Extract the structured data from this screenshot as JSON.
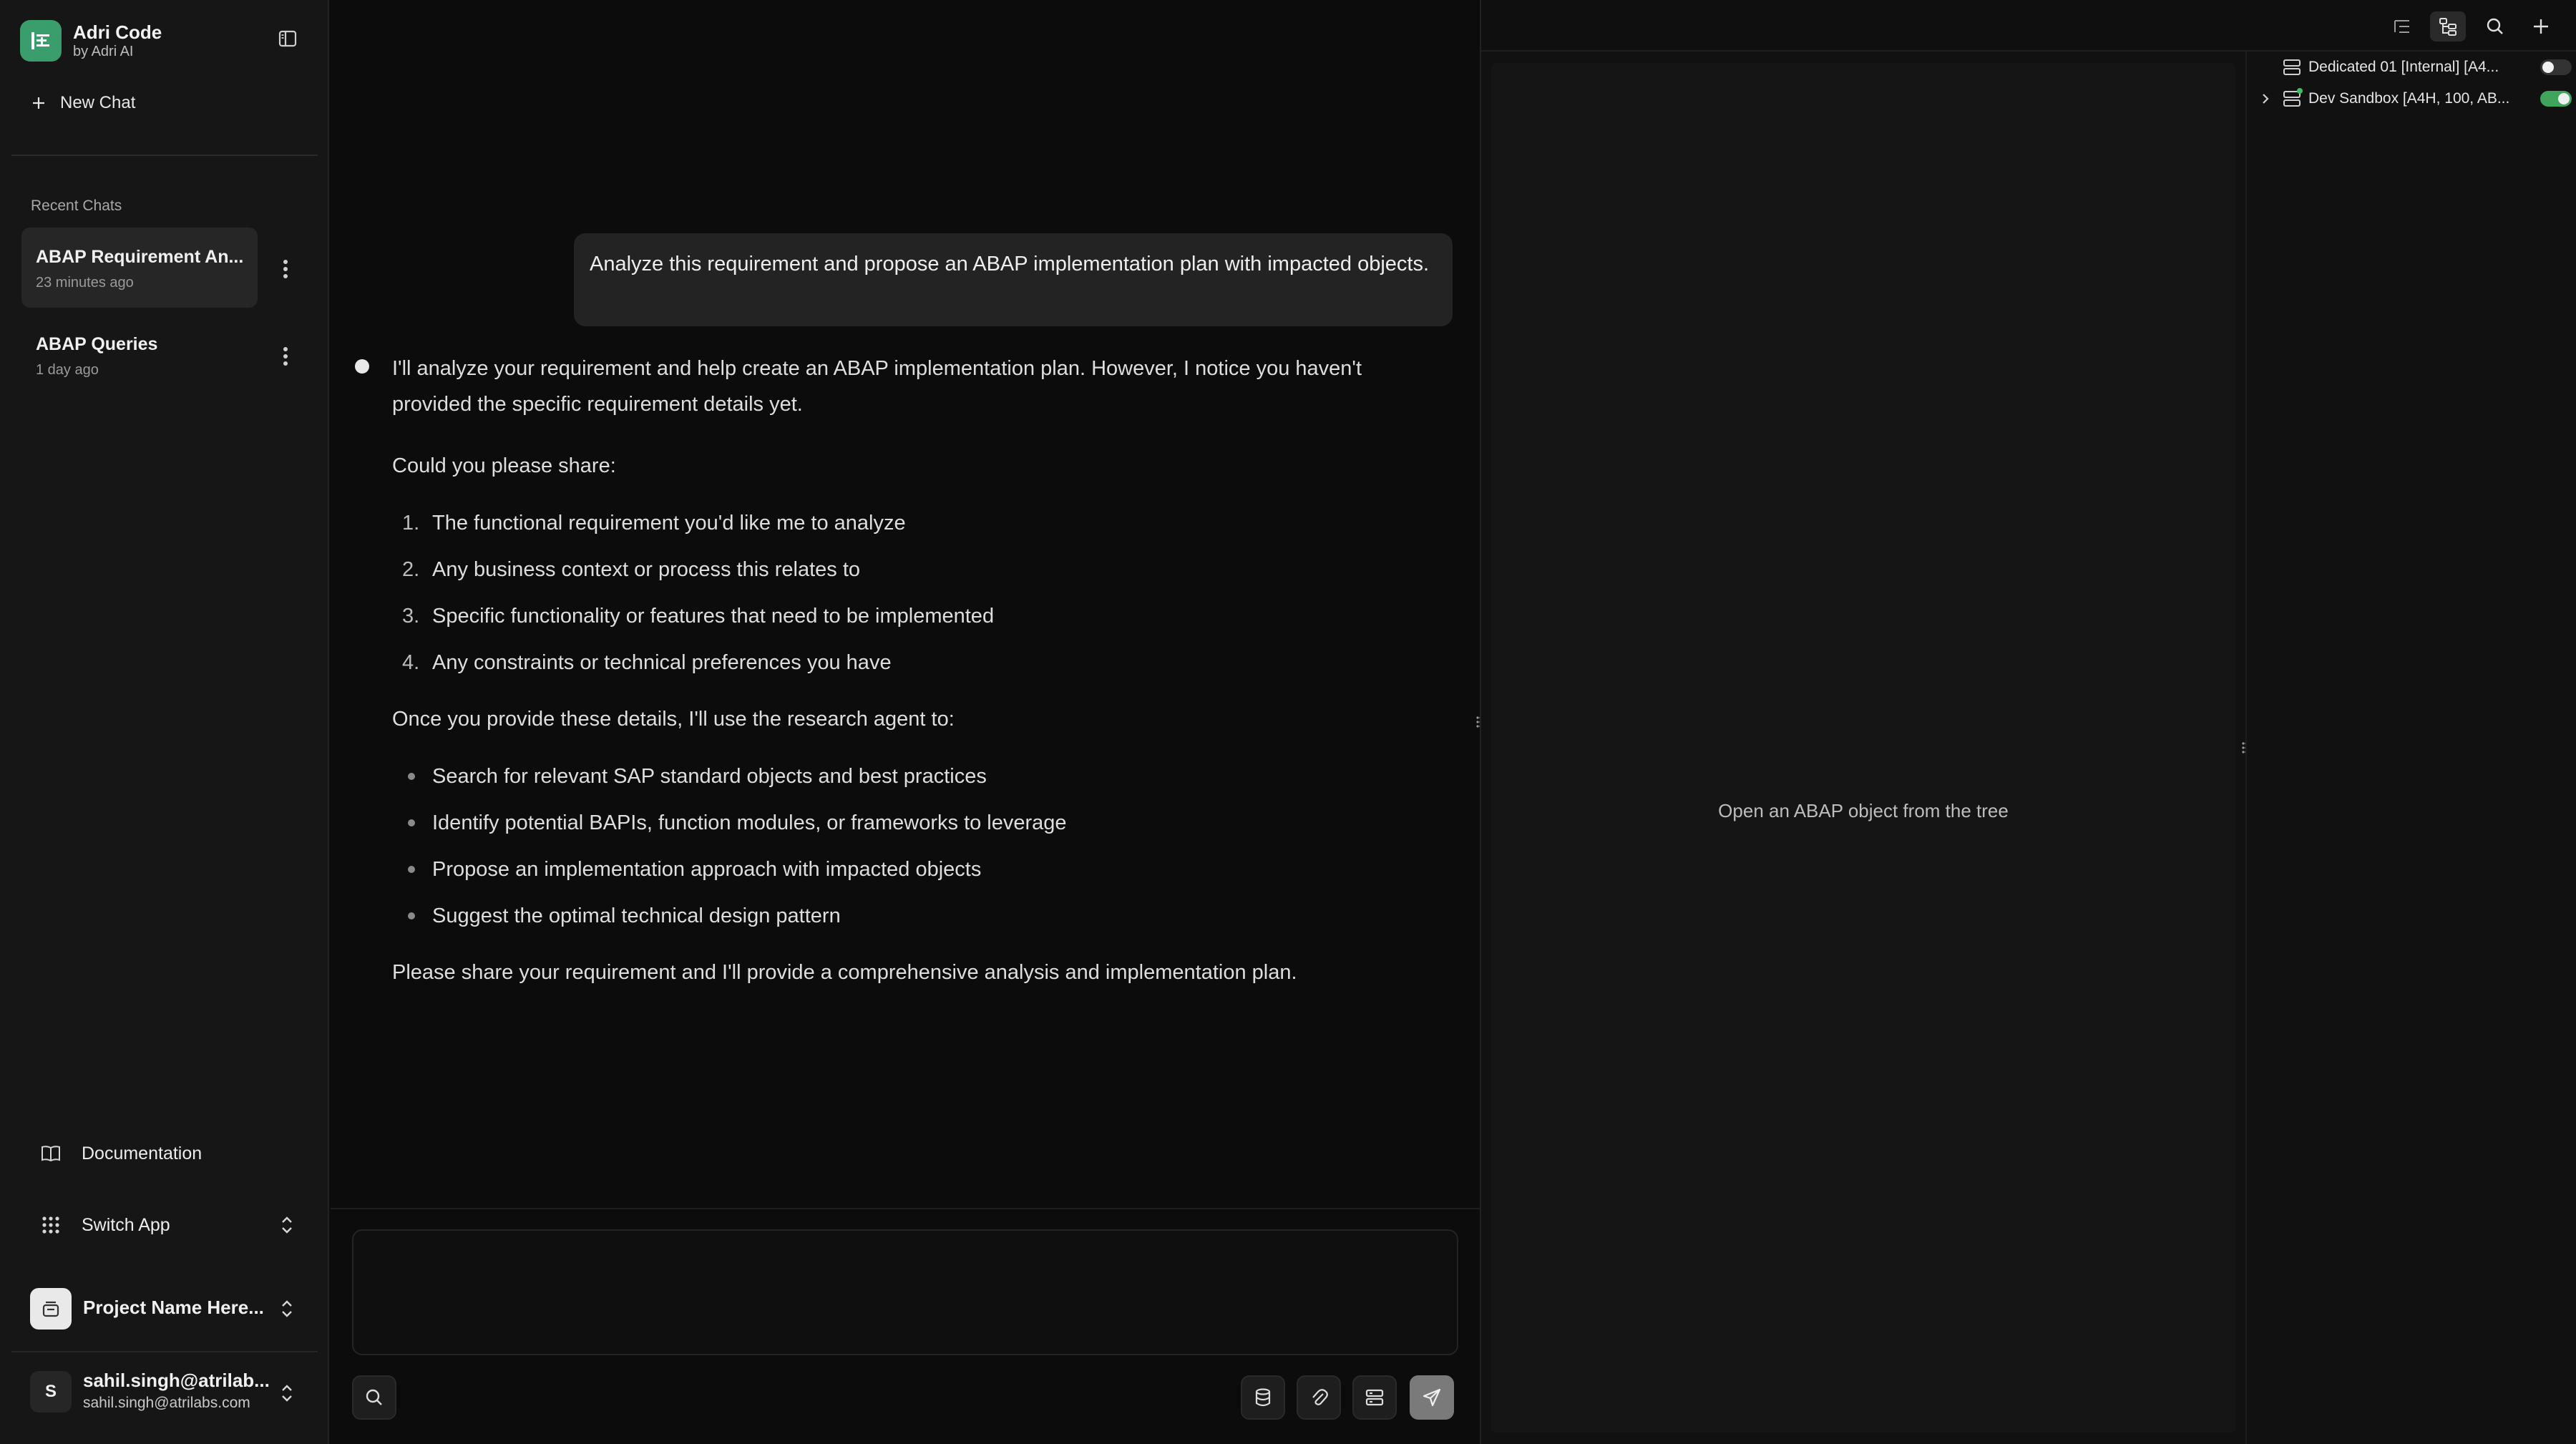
{
  "brand": {
    "name": "Adri Code",
    "subtitle": "by Adri AI"
  },
  "sidebar": {
    "new_chat_label": "New Chat",
    "recent_label": "Recent Chats",
    "chats": [
      {
        "title": "ABAP Requirement An...",
        "time": "23 minutes ago",
        "active": true
      },
      {
        "title": "ABAP Queries",
        "time": "1 day ago",
        "active": false
      }
    ],
    "documentation_label": "Documentation",
    "switch_app_label": "Switch App",
    "project_name": "Project Name Here...",
    "user": {
      "initial": "S",
      "name": "sahil.singh@atrilab...",
      "email": "sahil.singh@atrilabs.com"
    }
  },
  "conversation": {
    "user_message": "Analyze this requirement and propose an ABAP implementation plan with impacted objects.",
    "assistant": {
      "intro": "I'll analyze your requirement and help create an ABAP implementation plan. However, I notice you haven't provided the specific requirement details yet.",
      "ask": "Could you please share:",
      "numbered": [
        "The functional requirement you'd like me to analyze",
        "Any business context or process this relates to",
        "Specific functionality or features that need to be implemented",
        "Any constraints or technical preferences you have"
      ],
      "numbers": [
        "1.",
        "2.",
        "3.",
        "4."
      ],
      "followup": "Once you provide these details, I'll use the research agent to:",
      "bullets": [
        "Search for relevant SAP standard objects and best practices",
        "Identify potential BAPIs, function modules, or frameworks to leverage",
        "Propose an implementation approach with impacted objects",
        "Suggest the optimal technical design pattern"
      ],
      "closing": "Please share your requirement and I'll provide a comprehensive analysis and implementation plan."
    }
  },
  "editor": {
    "empty_text": "Open an ABAP object from the tree"
  },
  "tree": {
    "systems": [
      {
        "label": "Dedicated 01 [Internal] [A4...",
        "enabled": false,
        "expandable": false
      },
      {
        "label": "Dev Sandbox [A4H, 100, AB...",
        "enabled": true,
        "expandable": true
      }
    ]
  },
  "colors": {
    "accent": "#3a9e6c",
    "toggle_on": "#3fa55c",
    "background": "#0c0c0c",
    "sidebar": "#161616"
  }
}
